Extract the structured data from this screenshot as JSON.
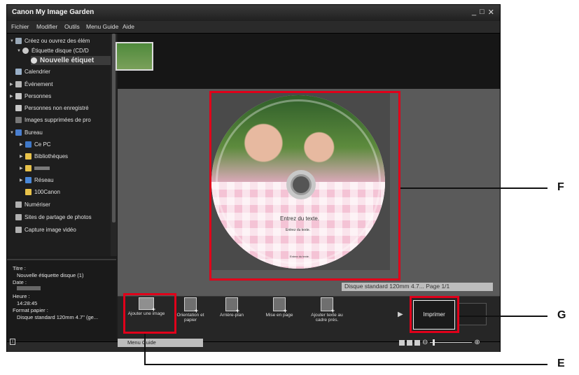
{
  "window": {
    "title": "Canon My Image Garden",
    "controls": [
      "_",
      "□",
      "✕"
    ]
  },
  "menu": [
    "Fichier",
    "Modifier",
    "Outils",
    "Menu Guide",
    "Aide"
  ],
  "sidebar": {
    "items": [
      {
        "label": "Créez ou ouvrez des élém",
        "arrow": "▼",
        "icon": "#9aa9b8"
      },
      {
        "label": "Étiquette disque (CD/D",
        "arrow": "▼",
        "icon": "#c8c8c8"
      },
      {
        "label": "Nouvelle étiquet",
        "arrow": "",
        "icon": "#dcdcdc"
      },
      {
        "label": "Calendrier",
        "arrow": "",
        "icon": "#9ab0c8"
      },
      {
        "label": "Événement",
        "arrow": "▶",
        "icon": "#b8b8b8"
      },
      {
        "label": "Personnes",
        "arrow": "▶",
        "icon": "#c8c8c8"
      },
      {
        "label": "Personnes non enregistré",
        "arrow": "",
        "icon": "#c8c8c8"
      },
      {
        "label": "Images supprimées de pro",
        "arrow": "",
        "icon": "#777777"
      },
      {
        "label": "Bureau",
        "arrow": "▼",
        "icon": "#4a7fd0"
      },
      {
        "label": "Ce PC",
        "arrow": "▶",
        "icon": "#3f78c8"
      },
      {
        "label": "Bibliothèques",
        "arrow": "▶",
        "icon": "#e8c24a"
      },
      {
        "label": "",
        "arrow": "▶",
        "icon": "#e8c24a"
      },
      {
        "label": "Réseau",
        "arrow": "▶",
        "icon": "#4a88d8"
      },
      {
        "label": "100Canon",
        "arrow": "",
        "icon": "#e8c24a"
      },
      {
        "label": "Numériser",
        "arrow": "",
        "icon": "#b0b0b0"
      },
      {
        "label": "Sites de partage de photos",
        "arrow": "",
        "icon": "#b0b0b0"
      },
      {
        "label": "Capture image vidéo",
        "arrow": "",
        "icon": "#b0b0b0"
      }
    ]
  },
  "info": {
    "lines": [
      "Titre :",
      "Nouvelle étiquette disque (1)",
      "Date :",
      "",
      "Heure :",
      "14:28:45",
      "Format papier :",
      "Disque standard 120mm 4.7\" (ge..."
    ]
  },
  "disc": {
    "title": "Entrez du texte.",
    "subtitle": "Entrez du texte.",
    "footer": "Entrez du texte."
  },
  "canvas_status": "Disque standard 120mm 4.7...  Page 1/1",
  "toolbar": {
    "buttons": [
      {
        "label": "Ajouter une image"
      },
      {
        "label": "Orientation et papier"
      },
      {
        "label": "Arrière-plan"
      },
      {
        "label": "Mise en page"
      },
      {
        "label": "Ajouter texte au cadre prés."
      }
    ],
    "arrow": "▶",
    "print_label": "Imprimer"
  },
  "bottom": {
    "guide_tab": "Menu Guide",
    "zoom_plus": "⊕",
    "zoom_minus": "⊖",
    "info_icon": "i"
  },
  "callouts": {
    "F": "F",
    "G": "G",
    "E": "E"
  },
  "colors": {
    "highlight_red": "#e0001a",
    "window_bg": "#1c1c1c",
    "canvas_bg": "#5a5a5a",
    "disc_pink": "#f4c3d5"
  }
}
